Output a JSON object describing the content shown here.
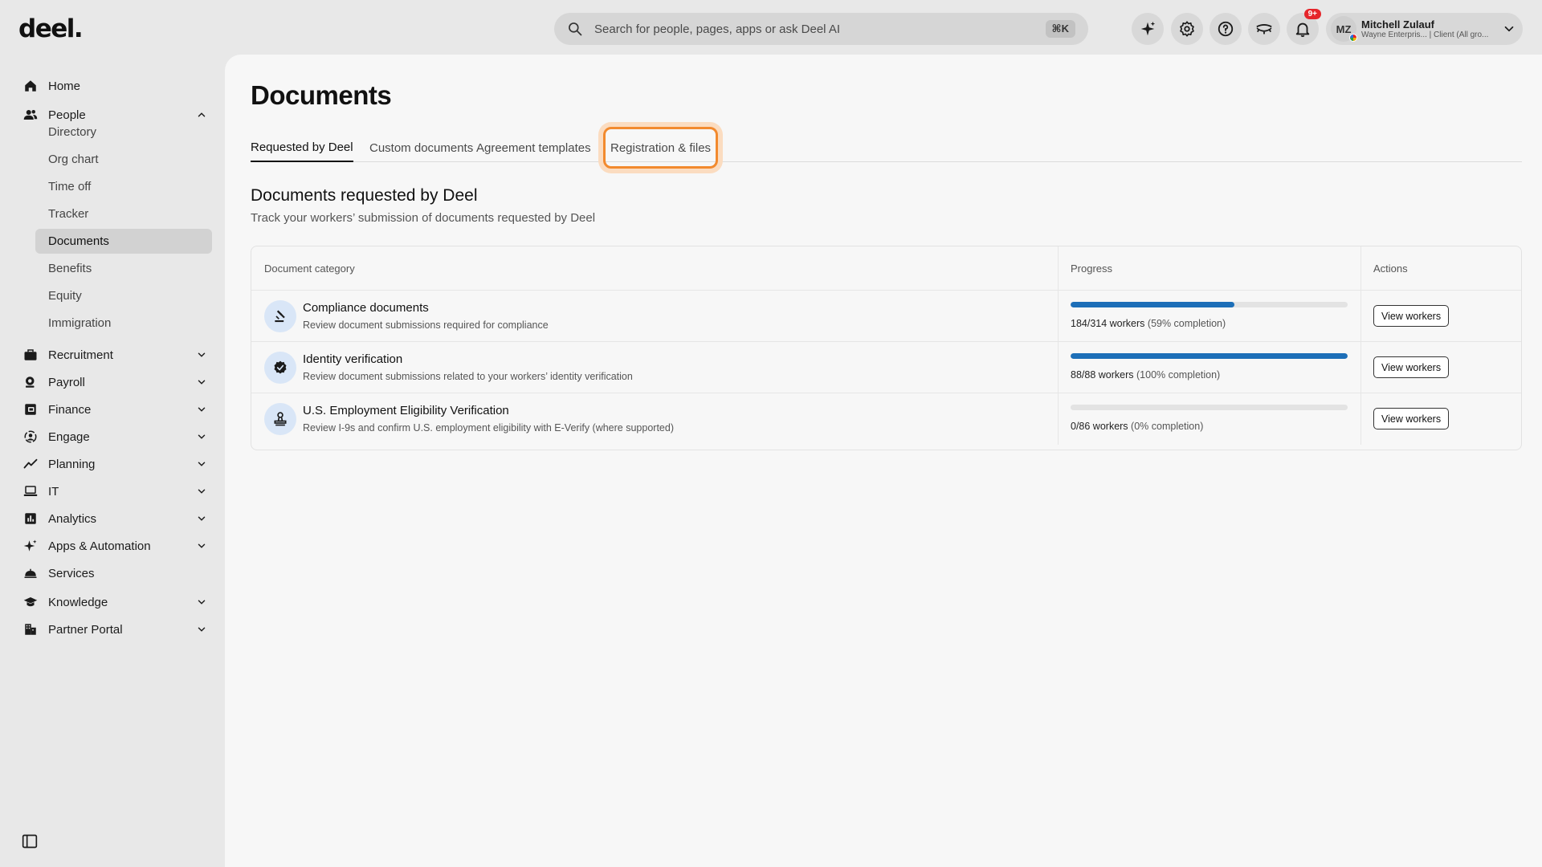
{
  "topbar": {
    "logo": "deel.",
    "search_placeholder": "Search for people, pages, apps or ask Deel AI",
    "search_shortcut": "⌘K",
    "notif_badge": "9+",
    "user": {
      "initials": "MZ",
      "name": "Mitchell Zulauf",
      "org": "Wayne Enterpris... | Client (All gro..."
    }
  },
  "sidebar": {
    "items": [
      {
        "label": "Home",
        "icon": "home-icon"
      },
      {
        "label": "People",
        "icon": "people-icon",
        "expanded": true
      },
      {
        "label": "Recruitment",
        "icon": "briefcase-icon"
      },
      {
        "label": "Payroll",
        "icon": "payroll-icon"
      },
      {
        "label": "Finance",
        "icon": "finance-icon"
      },
      {
        "label": "Engage",
        "icon": "engage-icon"
      },
      {
        "label": "Planning",
        "icon": "trend-icon"
      },
      {
        "label": "IT",
        "icon": "laptop-icon"
      },
      {
        "label": "Analytics",
        "icon": "analytics-icon"
      },
      {
        "label": "Apps & Automation",
        "icon": "sparkle-icon"
      },
      {
        "label": "Services",
        "icon": "bell-service-icon"
      },
      {
        "label": "Knowledge",
        "icon": "graduation-cap-icon"
      },
      {
        "label": "Partner Portal",
        "icon": "building-icon"
      }
    ],
    "people_sub": [
      "Directory",
      "Org chart",
      "Time off",
      "Tracker",
      "Documents",
      "Benefits",
      "Equity",
      "Immigration"
    ],
    "active_sub": "Documents"
  },
  "main": {
    "title": "Documents",
    "tabs": [
      "Requested by Deel",
      "Custom documents",
      "Agreement templates",
      "Registration & files"
    ],
    "active_tab": "Requested by Deel",
    "highlighted_tab": "Registration & files",
    "section_title": "Documents requested by Deel",
    "section_subtitle": "Track your workers’ submission of documents requested by Deel",
    "table": {
      "headers": [
        "Document category",
        "Progress",
        "Actions"
      ],
      "rows": [
        {
          "title": "Compliance documents",
          "desc": "Review document submissions required for compliance",
          "count": "184/314 workers",
          "pct": "(59% completion)",
          "progress": 0.59,
          "action": "View workers",
          "icon": "gavel-icon"
        },
        {
          "title": "Identity verification",
          "desc": "Review document submissions related to your workers’ identity verification",
          "count": "88/88 workers",
          "pct": "(100% completion)",
          "progress": 1.0,
          "action": "View workers",
          "icon": "verified-badge-icon"
        },
        {
          "title": "U.S. Employment Eligibility Verification",
          "desc": "Review I-9s and confirm U.S. employment eligibility with E-Verify (where supported)",
          "count": "0/86 workers",
          "pct": "(0% completion)",
          "progress": 0.0,
          "action": "View workers",
          "icon": "stamp-icon"
        }
      ]
    }
  },
  "colors": {
    "accent": "#1d6fb8",
    "highlight": "#f28a2e",
    "badge": "#e5252a"
  }
}
